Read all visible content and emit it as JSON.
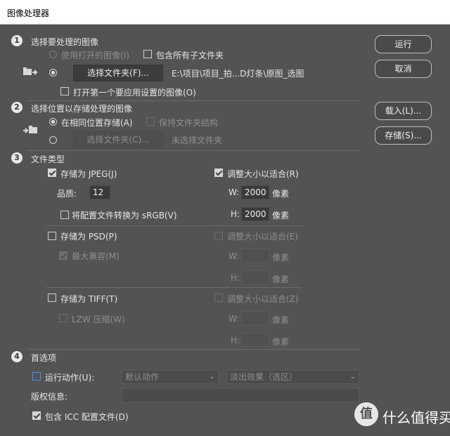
{
  "window": {
    "title": "图像处理器"
  },
  "buttons": {
    "run": "运行",
    "cancel": "取消",
    "load": "载入(L)...",
    "save": "存储(S)..."
  },
  "section1": {
    "number": "1",
    "title": "选择要处理的图像",
    "use_open_images": "使用打开的图像(I)",
    "include_subfolders": "包含所有子文件夹",
    "select_folder_button": "选择文件夹(F)...",
    "folder_path": "E:\\项目\\项目_拍...D灯条\\原图_选图",
    "open_first_image": "打开第一个要应用设置的图像(O)"
  },
  "section2": {
    "number": "2",
    "title": "选择位置以存储处理的图像",
    "same_location": "在相同位置存储(A)",
    "keep_structure": "保持文件夹结构",
    "select_folder_button": "选择文件夹(C)...",
    "no_folder": "未选择文件夹"
  },
  "section3": {
    "number": "3",
    "title": "文件类型",
    "jpeg": {
      "save_as": "存储为 JPEG(J)",
      "resize": "调整大小以适合(R)",
      "quality_label": "品质:",
      "quality": "12",
      "w_label": "W:",
      "w_value": "2000",
      "w_unit": "像素",
      "h_label": "H:",
      "h_value": "2000",
      "h_unit": "像素",
      "srgb": "将配置文件转换为 sRGB(V)"
    },
    "psd": {
      "save_as": "存储为 PSD(P)",
      "resize": "调整大小以适合(E)",
      "max_compat": "最大兼容(M)",
      "w_label": "W:",
      "w_unit": "像素",
      "h_label": "H:",
      "h_unit": "像素"
    },
    "tiff": {
      "save_as": "存储为 TIFF(T)",
      "resize": "调整大小以适合(Z)",
      "lzw": "LZW 压缩(W)",
      "w_label": "W:",
      "w_unit": "像素",
      "h_label": "H:",
      "h_unit": "像素"
    }
  },
  "section4": {
    "number": "4",
    "title": "首选项",
    "run_action": "运行动作(U):",
    "action_set": "默认动作",
    "action": "淡出效果（选区）",
    "copyright_label": "版权信息:",
    "include_icc": "包含 ICC 配置文件(D)"
  },
  "watermark": {
    "text": "什么值得买",
    "badge": "值"
  }
}
